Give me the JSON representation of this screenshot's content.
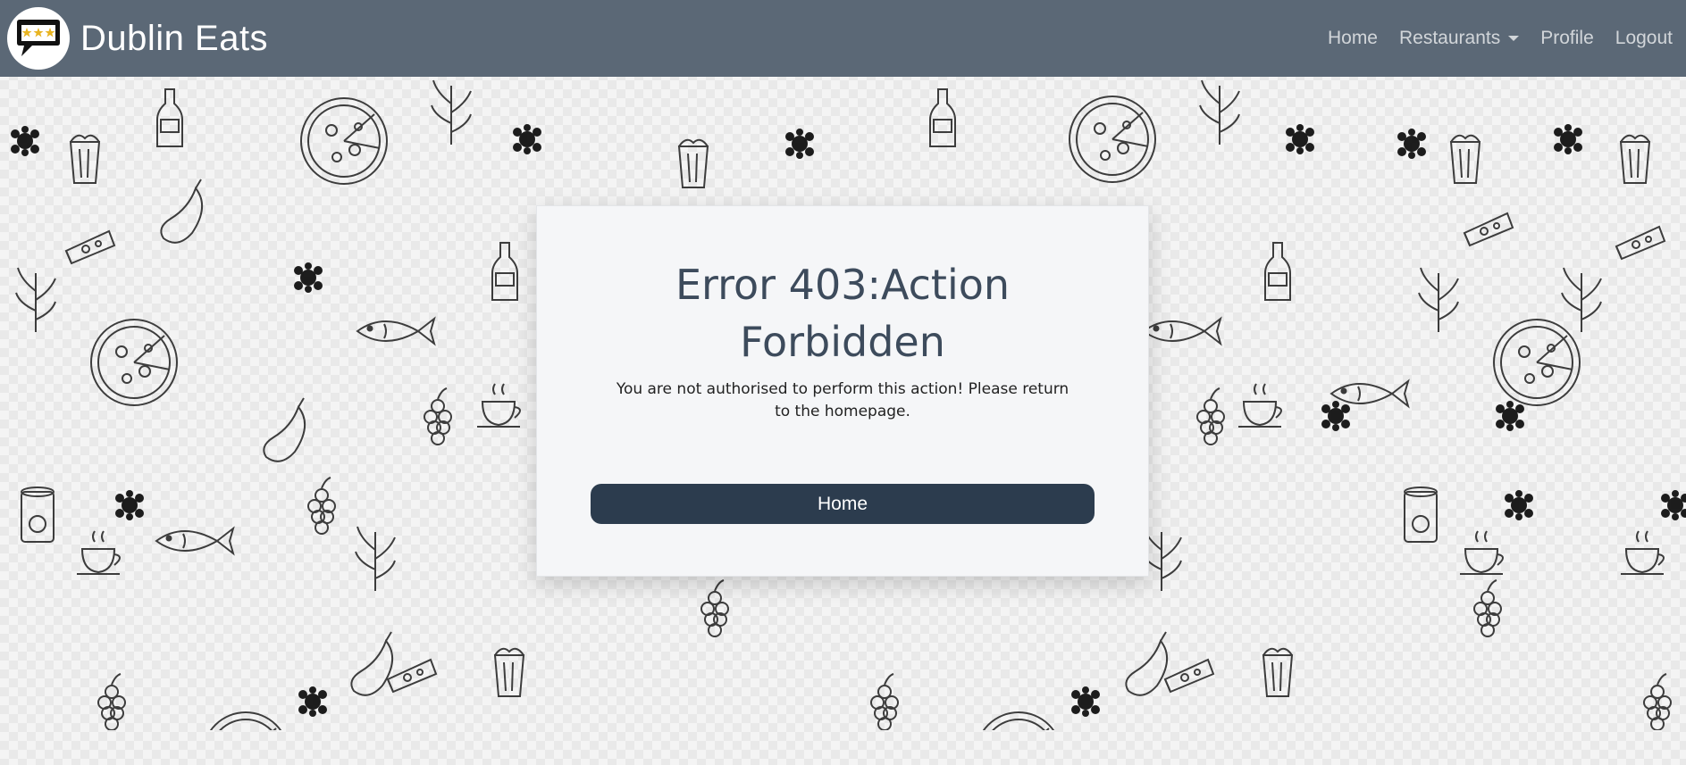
{
  "navbar": {
    "brand_name": "Dublin Eats",
    "logo_icon": "speech-bubble-stars-icon",
    "links": {
      "home": "Home",
      "restaurants": "Restaurants",
      "profile": "Profile",
      "logout": "Logout"
    },
    "background_color": "#5b6876"
  },
  "error_card": {
    "title": "Error 403:Action Forbidden",
    "message": "You are not authorised to perform this action! Please return to the homepage.",
    "button_label": "Home",
    "button_color": "#2c3c4e"
  },
  "background": {
    "pattern": "hand-drawn food doodles"
  }
}
